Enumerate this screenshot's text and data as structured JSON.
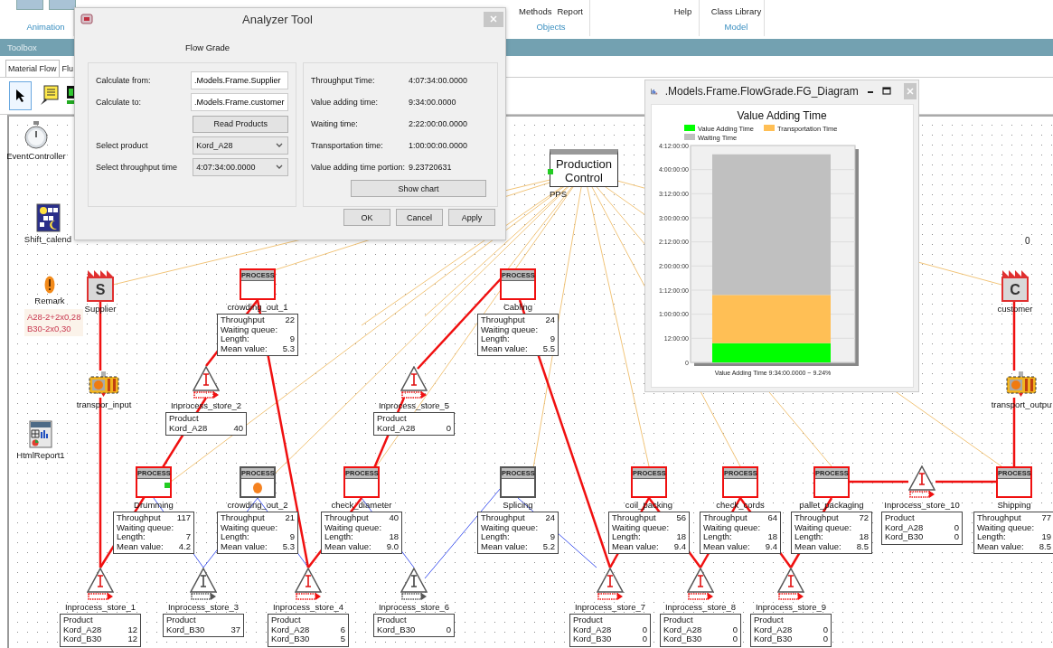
{
  "ribbon": {
    "groups": [
      {
        "label": "Animation"
      },
      {
        "items": [
          "Methods",
          "Report"
        ],
        "label": "Objects"
      },
      {
        "items": [
          "Help"
        ]
      },
      {
        "items": [
          "Class Library"
        ],
        "label": "Model"
      }
    ]
  },
  "toolbox": {
    "title": "Toolbox",
    "tabs": [
      {
        "label": "Material Flow",
        "selected": true
      },
      {
        "label": "Flu",
        "selected": false
      }
    ]
  },
  "canvas": {
    "objects": [
      {
        "kind": "event_controller",
        "label": "EventController"
      },
      {
        "kind": "calendar",
        "label": "Shift_calend"
      },
      {
        "kind": "remark",
        "label": "Remark",
        "lines": [
          "A28-2+2x0,28",
          "B30-2x0,30"
        ]
      },
      {
        "kind": "html_report",
        "label": "HtmlReport1"
      },
      {
        "kind": "source",
        "label": "Supplier",
        "letter": "S"
      },
      {
        "kind": "source",
        "label": "customer",
        "letter": "C"
      },
      {
        "kind": "transporter",
        "label": "transpor_input"
      },
      {
        "kind": "transporter",
        "label": "transport_outpu"
      },
      {
        "kind": "controller",
        "label": "PPS",
        "title": "Production Control"
      }
    ],
    "counter": "0",
    "processes": [
      {
        "label": "crowding_out_1",
        "header": "PROCESS",
        "active": true,
        "busy": false,
        "ready": false,
        "stats": [
          {
            "label": "Throughput",
            "value": "22"
          },
          {
            "label": "Waiting queue:"
          },
          {
            "label": "Length:",
            "value": "9"
          },
          {
            "label": "Mean value:",
            "value": "5.3"
          }
        ]
      },
      {
        "label": "Cabling",
        "header": "PROCESS",
        "active": true,
        "busy": false,
        "ready": false,
        "stats": [
          {
            "label": "Throughput",
            "value": "24"
          },
          {
            "label": "Waiting queue:"
          },
          {
            "label": "Length:",
            "value": "9"
          },
          {
            "label": "Mean value:",
            "value": "5.5"
          }
        ]
      },
      {
        "label": "Drumming",
        "header": "PROCESS",
        "active": true,
        "busy": false,
        "ready": true,
        "stats": [
          {
            "label": "Throughput",
            "value": "117"
          },
          {
            "label": "Waiting queue:"
          },
          {
            "label": "Length:",
            "value": "7"
          },
          {
            "label": "Mean value:",
            "value": "4.2"
          }
        ]
      },
      {
        "label": "crowding_out_2",
        "header": "PROCESS",
        "active": false,
        "busy": true,
        "ready": false,
        "stats": [
          {
            "label": "Throughput",
            "value": "21"
          },
          {
            "label": "Waiting queue:"
          },
          {
            "label": "Length:",
            "value": "9"
          },
          {
            "label": "Mean value:",
            "value": "5.3"
          }
        ]
      },
      {
        "label": "check_diameter",
        "header": "PROCESS",
        "active": true,
        "busy": false,
        "ready": false,
        "stats": [
          {
            "label": "Throughput",
            "value": "40"
          },
          {
            "label": "Waiting queue:"
          },
          {
            "label": "Length:",
            "value": "18"
          },
          {
            "label": "Mean value:",
            "value": "9.0"
          }
        ]
      },
      {
        "label": "Splicing",
        "header": "PROCESS",
        "active": false,
        "busy": false,
        "ready": false,
        "stats": [
          {
            "label": "Throughput",
            "value": "24"
          },
          {
            "label": "Waiting queue:"
          },
          {
            "label": "Length:",
            "value": "9"
          },
          {
            "label": "Mean value:",
            "value": "5.2"
          }
        ]
      },
      {
        "label": "coil_packing",
        "header": "PROCESS",
        "active": true,
        "busy": false,
        "ready": false,
        "stats": [
          {
            "label": "Throughput",
            "value": "56"
          },
          {
            "label": "Waiting queue:"
          },
          {
            "label": "Length:",
            "value": "18"
          },
          {
            "label": "Mean value:",
            "value": "9.4"
          }
        ]
      },
      {
        "label": "check_cords",
        "header": "PROCESS",
        "active": true,
        "busy": false,
        "ready": false,
        "stats": [
          {
            "label": "Throughput",
            "value": "64"
          },
          {
            "label": "Waiting queue:"
          },
          {
            "label": "Length:",
            "value": "18"
          },
          {
            "label": "Mean value:",
            "value": "9.4"
          }
        ]
      },
      {
        "label": "pallet_packaging",
        "header": "PROCESS",
        "active": true,
        "busy": false,
        "ready": false,
        "stats": [
          {
            "label": "Throughput",
            "value": "72"
          },
          {
            "label": "Waiting queue:"
          },
          {
            "label": "Length:",
            "value": "18"
          },
          {
            "label": "Mean value:",
            "value": "8.5"
          }
        ]
      },
      {
        "label": "Shipping",
        "header": "PROCESS",
        "active": true,
        "busy": false,
        "ready": false,
        "stats": [
          {
            "label": "Throughput",
            "value": "77"
          },
          {
            "label": "Waiting queue:"
          },
          {
            "label": "Length:",
            "value": "19"
          },
          {
            "label": "Mean value:",
            "value": "8.5"
          }
        ]
      }
    ],
    "stores": [
      {
        "label": "Inprocess_store_2",
        "active": true,
        "header": "Product",
        "rows": [
          {
            "label": "Kord_A28",
            "value": "40"
          }
        ]
      },
      {
        "label": "Inprocess_store_5",
        "active": true,
        "header": "Product",
        "rows": [
          {
            "label": "Kord_A28",
            "value": "0"
          }
        ]
      },
      {
        "label": "Inprocess_store_10",
        "active": true,
        "header": "Product",
        "rows": [
          {
            "label": "Kord_A28",
            "value": "0"
          },
          {
            "label": "Kord_B30",
            "value": "0"
          }
        ]
      },
      {
        "label": "Inprocess_store_1",
        "active": true,
        "header": "Product",
        "rows": [
          {
            "label": "Kord_A28",
            "value": "12"
          },
          {
            "label": "Kord_B30",
            "value": "12"
          }
        ]
      },
      {
        "label": "Inprocess_store_3",
        "active": false,
        "header": "Product",
        "rows": [
          {
            "label": "Kord_B30",
            "value": "37"
          }
        ]
      },
      {
        "label": "Inprocess_store_4",
        "active": true,
        "header": "Product",
        "rows": [
          {
            "label": "Kord_A28",
            "value": "6"
          },
          {
            "label": "Kord_B30",
            "value": "5"
          }
        ]
      },
      {
        "label": "Inprocess_store_6",
        "active": false,
        "header": "Product",
        "rows": [
          {
            "label": "Kord_B30",
            "value": "0"
          }
        ]
      },
      {
        "label": "Inprocess_store_7",
        "active": true,
        "header": "Product",
        "rows": [
          {
            "label": "Kord_A28",
            "value": "0"
          },
          {
            "label": "Kord_B30",
            "value": "0"
          }
        ]
      },
      {
        "label": "Inprocess_store_8",
        "active": true,
        "header": "Product",
        "rows": [
          {
            "label": "Kord_A28",
            "value": "0"
          },
          {
            "label": "Kord_B30",
            "value": "0"
          }
        ]
      },
      {
        "label": "Inprocess_store_9",
        "active": true,
        "header": "Product",
        "rows": [
          {
            "label": "Kord_A28",
            "value": "0"
          },
          {
            "label": "Kord_B30",
            "value": "0"
          }
        ]
      }
    ]
  },
  "analyzer": {
    "title": "Analyzer Tool",
    "section": "Flow Grade",
    "inputs": [
      {
        "kind": "text",
        "label": "Calculate from:",
        "value": ".Models.Frame.Supplier"
      },
      {
        "kind": "text",
        "label": "Calculate to:",
        "value": ".Models.Frame.customer"
      },
      {
        "kind": "button",
        "label": "Read Products"
      },
      {
        "kind": "select",
        "label": "Select product",
        "value": "Kord_A28"
      },
      {
        "kind": "select",
        "label": "Select throughput time",
        "value": "4:07:34:00.0000"
      }
    ],
    "results": [
      {
        "label": "Throughput Time:",
        "value": "4:07:34:00.0000"
      },
      {
        "label": "Value adding time:",
        "value": "9:34:00.0000"
      },
      {
        "label": "Waiting time:",
        "value": "2:22:00:00.0000"
      },
      {
        "label": "Transportation time:",
        "value": "1:00:00:00.0000"
      },
      {
        "label": "Value adding time portion:",
        "value": "9.23720631"
      }
    ],
    "chart_button": "Show chart",
    "buttons": [
      "OK",
      "Cancel",
      "Apply"
    ]
  },
  "chart_window": {
    "title": ".Models.Frame.FlowGrade.FG_Diagram",
    "chart_data": {
      "type": "bar",
      "stacked": true,
      "grid": true,
      "legend": true,
      "title": "Value Adding Time",
      "categories": [
        "Value Adding  Time 9:34:00.0000 ~ 9.24%"
      ],
      "series": [
        {
          "name": "Value Adding Time",
          "color": "#00ff00",
          "values": [
            9.6
          ]
        },
        {
          "name": "Transportation Time",
          "color": "#ffbf55",
          "values": [
            24
          ]
        },
        {
          "name": "Waiting Time",
          "color": "#c0c0c0",
          "values": [
            70
          ]
        }
      ],
      "ylim": [
        0,
        108
      ],
      "yticks": [
        {
          "value": 0,
          "label": "0"
        },
        {
          "value": 12,
          "label": "12:00:00"
        },
        {
          "value": 24,
          "label": "1:00:00:00"
        },
        {
          "value": 36,
          "label": "1:12:00:00"
        },
        {
          "value": 48,
          "label": "2:00:00:00"
        },
        {
          "value": 60,
          "label": "2:12:00:00"
        },
        {
          "value": 72,
          "label": "3:00:00:00"
        },
        {
          "value": 84,
          "label": "3:12:00:00"
        },
        {
          "value": 96,
          "label": "4:00:00:00"
        },
        {
          "value": 108,
          "label": "4:12:00:00"
        }
      ]
    }
  }
}
